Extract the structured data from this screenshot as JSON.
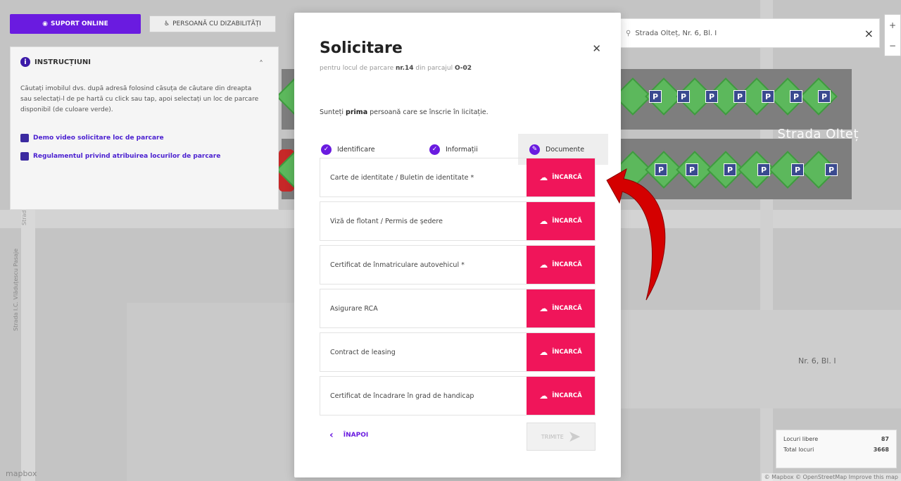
{
  "header": {
    "support_label": "SUPORT ONLINE",
    "disability_label": "PERSOANĂ CU DIZABILITĂȚI"
  },
  "instructions": {
    "title": "INSTRUCȚIUNI",
    "text": "Căutați imobilul dvs. după adresă folosind căsuța de căutare din dreapta sau selectați-l de pe hartă cu click sau tap, apoi selectați un loc de parcare disponibil (de culoare verde).",
    "link_video": "Demo video solicitare loc de parcare",
    "link_regulation": "Regulamentul privind atribuirea locurilor de parcare"
  },
  "search": {
    "value": "Strada Olteț, Nr. 6, Bl. I"
  },
  "map": {
    "street_label": "Strada Olteț",
    "address_label": "Nr. 6, Bl. I",
    "mapbox_label": "mapbox",
    "attribution": "© Mapbox © OpenStreetMap Improve this map",
    "vertical_street_1": "Strada I.C. Vlăduțescu Pasaje",
    "vertical_street_2": "Strada I.C. Vlăduțescu"
  },
  "stats": {
    "free_label": "Locuri libere",
    "free_value": "87",
    "total_label": "Total locuri",
    "total_value": "3668"
  },
  "modal": {
    "title": "Solicitare",
    "subtitle_pre": "pentru locul de parcare",
    "spot": "nr.14",
    "subtitle_mid": "din parcajul",
    "lot": "O-02",
    "note_pre": "Sunteți",
    "note_bold": "prima",
    "note_post": "persoană care se înscrie în licitație.",
    "steps": [
      {
        "label": "Identificare"
      },
      {
        "label": "Informații"
      },
      {
        "label": "Documente"
      }
    ],
    "upload_label": "ÎNCARCĂ",
    "documents": [
      {
        "label": "Carte de identitate / Buletin de identitate *"
      },
      {
        "label": "Viză de flotant / Permis de ședere"
      },
      {
        "label": "Certificat de înmatriculare autovehicul *"
      },
      {
        "label": "Asigurare RCA"
      },
      {
        "label": "Contract de leasing"
      },
      {
        "label": "Certificat de încadrare în grad de handicap"
      }
    ],
    "back_label": "ÎNAPOI",
    "send_label": "TRIMITE"
  },
  "colors": {
    "primary": "#6a1be0",
    "upload": "#f0155a",
    "available_spot": "#5cb85c"
  }
}
